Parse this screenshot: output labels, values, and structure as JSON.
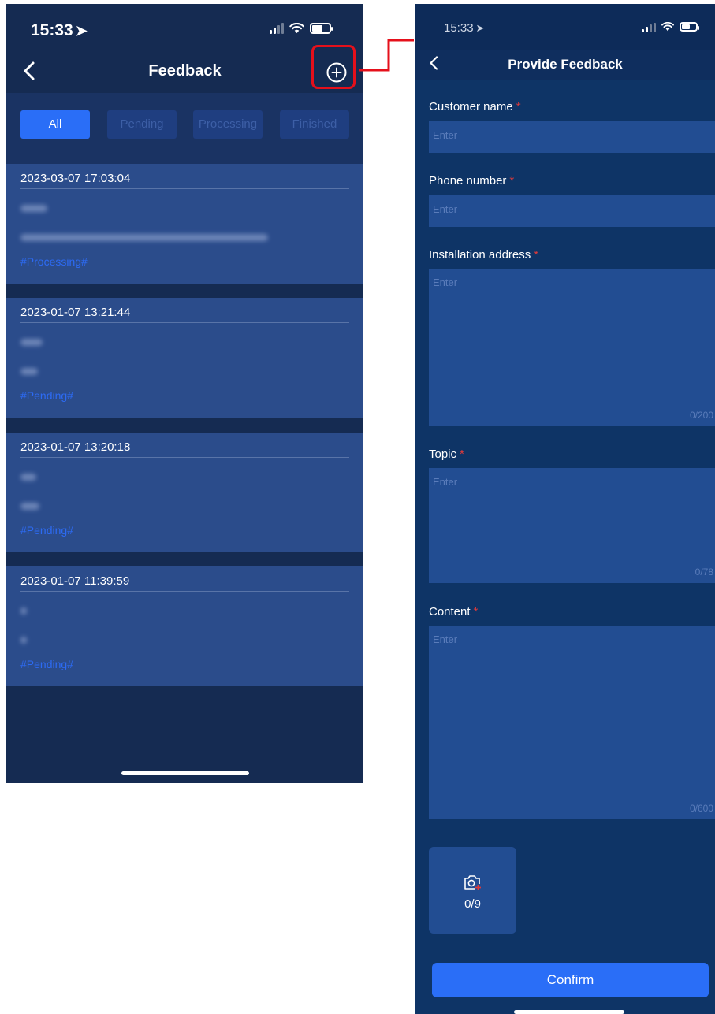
{
  "feedback_list": {
    "status_bar": {
      "time": "15:33",
      "location_arrow": "location-arrow-icon"
    },
    "nav": {
      "title": "Feedback",
      "back_icon": "chevron-left-icon",
      "add_icon": "plus-circle-icon"
    },
    "filter_tabs": [
      {
        "label": "All",
        "active": true
      },
      {
        "label": "Pending",
        "active": false
      },
      {
        "label": "Processing",
        "active": false
      },
      {
        "label": "Finished",
        "active": false
      }
    ],
    "items": [
      {
        "datetime": "2023-03-07 17:03:04",
        "status": "#Processing#"
      },
      {
        "datetime": "2023-01-07 13:21:44",
        "status": "#Pending#"
      },
      {
        "datetime": "2023-01-07 13:20:18",
        "status": "#Pending#"
      },
      {
        "datetime": "2023-01-07 11:39:59",
        "status": "#Pending#"
      }
    ]
  },
  "provide_feedback": {
    "status_bar": {
      "time": "15:33"
    },
    "nav": {
      "title": "Provide Feedback",
      "back_icon": "chevron-left-icon"
    },
    "fields": {
      "customer_name": {
        "label": "Customer name",
        "required_mark": "*",
        "placeholder": "Enter"
      },
      "phone_number": {
        "label": "Phone number",
        "required_mark": "*",
        "placeholder": "Enter"
      },
      "installation_address": {
        "label": "Installation address",
        "required_mark": "*",
        "placeholder": "Enter",
        "counter": "0/200"
      },
      "topic": {
        "label": "Topic",
        "required_mark": "*",
        "placeholder": "Enter",
        "counter": "0/78"
      },
      "content": {
        "label": "Content",
        "required_mark": "*",
        "placeholder": "Enter",
        "counter": "0/600"
      }
    },
    "photo_upload": {
      "icon": "camera-add-icon",
      "counter": "0/9"
    },
    "confirm_label": "Confirm"
  },
  "colors": {
    "accent": "#2a6ef7",
    "required": "#e03a3a",
    "highlight": "#e5101b",
    "status_text": "#2d6bf4"
  }
}
